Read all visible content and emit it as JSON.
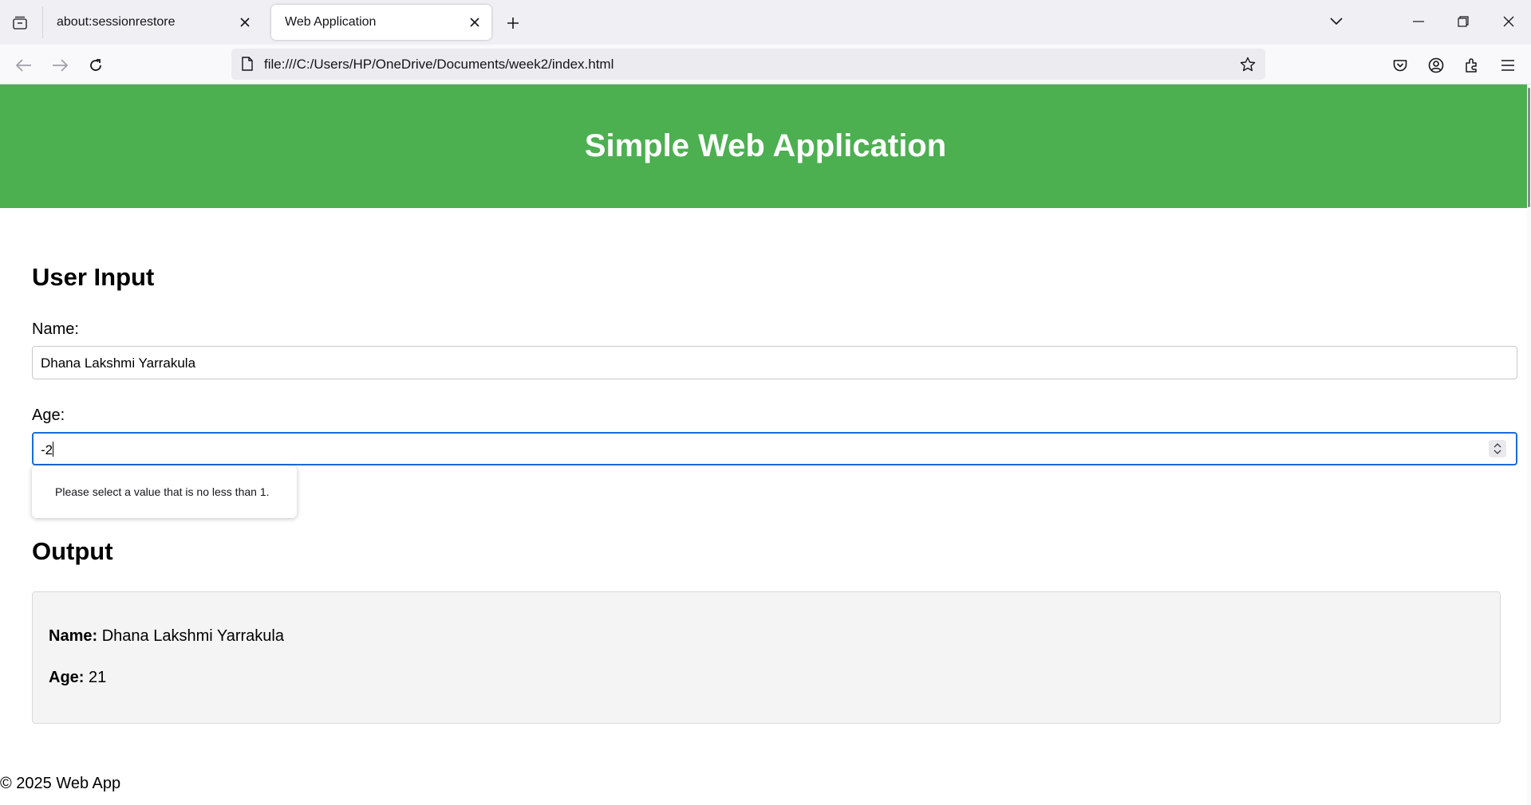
{
  "browser": {
    "tabs": [
      {
        "title": "about:sessionrestore",
        "active": false
      },
      {
        "title": "Web Application",
        "active": true
      }
    ],
    "url": "file:///C:/Users/HP/OneDrive/Documents/week2/index.html",
    "icons": [
      "tab-list-icon",
      "close-icon",
      "new-tab-icon",
      "chevron-down-icon",
      "minimize-icon",
      "restore-icon",
      "window-close-icon",
      "back-icon",
      "forward-icon",
      "reload-icon",
      "page-icon",
      "bookmark-star-icon",
      "pocket-icon",
      "account-icon",
      "extensions-icon",
      "menu-icon"
    ]
  },
  "page": {
    "header_title": "Simple Web Application",
    "input_section": {
      "heading": "User Input",
      "name_label": "Name:",
      "name_value": "Dhana Lakshmi Yarrakula",
      "age_label": "Age:",
      "age_value": "-2",
      "validation_message": "Please select a value that is no less than 1."
    },
    "output_section": {
      "heading": "Output",
      "name_label": "Name:",
      "name_value": "Dhana Lakshmi Yarrakula",
      "age_label": "Age:",
      "age_value": "21"
    },
    "footer": "© 2025 Web App"
  },
  "colors": {
    "header_bg": "#4caf50",
    "focus_ring": "#1d6ad8",
    "output_bg": "#f4f4f4"
  }
}
